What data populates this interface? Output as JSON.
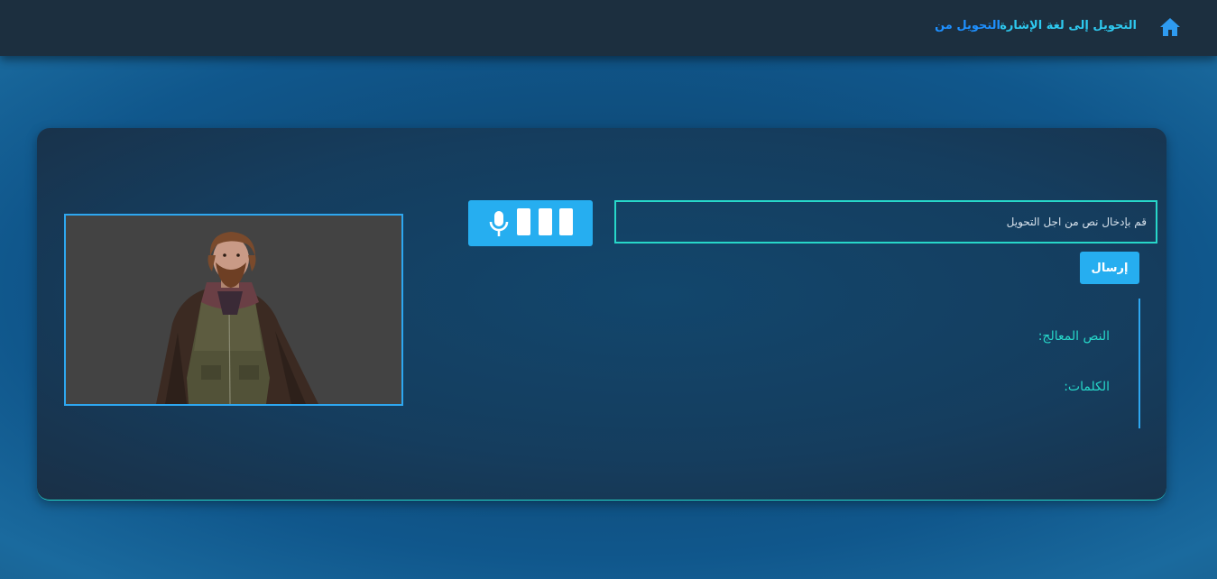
{
  "navbar": {
    "home_icon": "home-icon",
    "links": [
      {
        "label": "التحويل إلى لغة الإشارة",
        "color": "#2ec9ef"
      },
      {
        "label": "التحويل من",
        "color": "#1e90ff"
      }
    ]
  },
  "form": {
    "input_placeholder": "قم بإدخال نص من اجل التحويل",
    "input_value": "",
    "send_label": "إرسال",
    "mic_icon": "microphone-icon"
  },
  "output": {
    "processed_label": "النص المعالج:",
    "words_label": "الكلمات:"
  },
  "avatar": {
    "icon": "3d-avatar-figure"
  },
  "colors": {
    "accent_teal": "#27d7c9",
    "accent_blue": "#26aef0",
    "navbar_bg": "#1c2f3f"
  }
}
